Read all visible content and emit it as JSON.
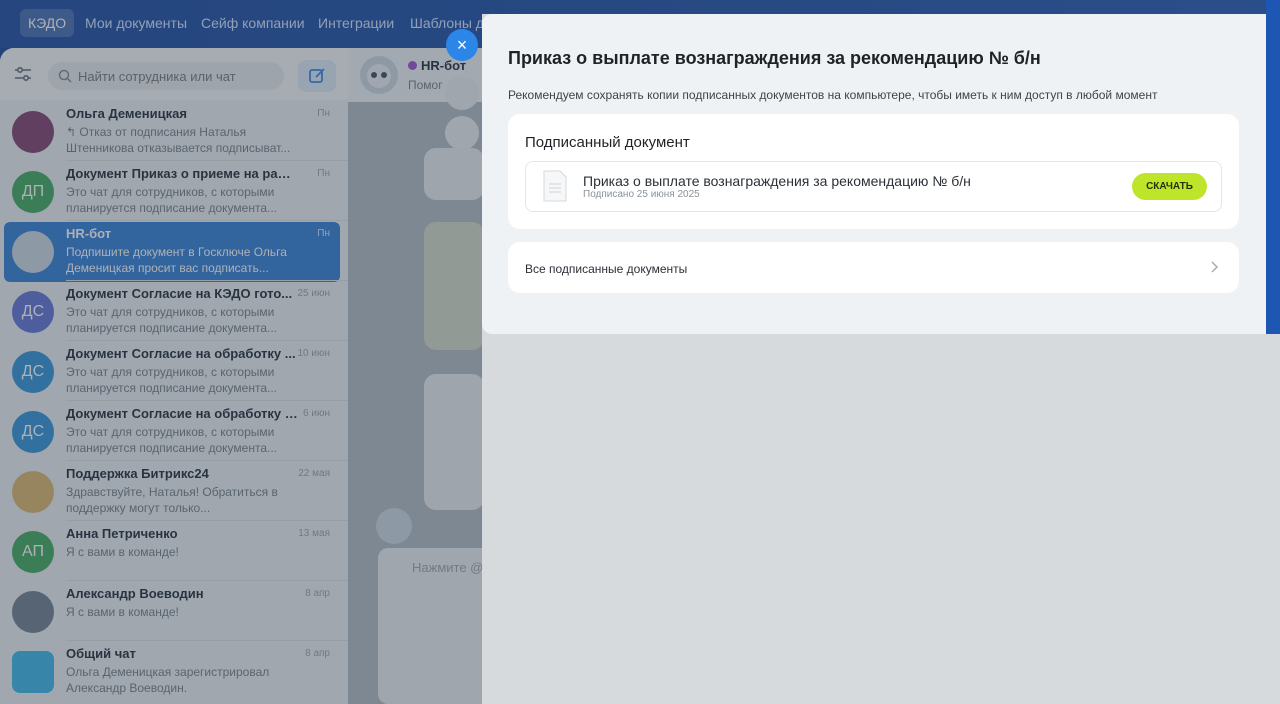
{
  "topnav": {
    "tabs": [
      {
        "label": "КЭДО",
        "active": true
      },
      {
        "label": "Мои документы"
      },
      {
        "label": "Сейф компании"
      },
      {
        "label": "Интеграции"
      },
      {
        "label": "Шаблоны д"
      }
    ]
  },
  "sidebar": {
    "search_placeholder": "Найти сотрудника или чат",
    "chats": [
      {
        "name": "Ольга Деменицкая",
        "date": "Пн",
        "preview": "↰ Отказ от подписания Наталья Штенникова отказывается подписыват...",
        "avatar": "photo"
      },
      {
        "name": "Документ Приказ о приеме на работ...",
        "date": "Пн",
        "preview": "Это чат для сотрудников, с которыми планируется подписание документа...",
        "initials": "ДП",
        "color": "#3aa65a"
      },
      {
        "name": "HR-бот",
        "date": "Пн",
        "preview": "Подпишите документ в Госключе Ольга Деменицкая просит вас подписать...",
        "avatar": "bot",
        "active": true
      },
      {
        "name": "Документ Согласие на КЭДО гото...",
        "date": "25 июн",
        "preview": "Это чат для сотрудников, с которыми планируется подписание документа...",
        "initials": "ДС",
        "color": "#5b6fd6"
      },
      {
        "name": "Документ Согласие на обработку ...",
        "date": "10 июн",
        "preview": "Это чат для сотрудников, с которыми планируется подписание документа...",
        "initials": "ДС",
        "color": "#2a8fd8"
      },
      {
        "name": "Документ Согласие на обработку п...",
        "date": "6 июн",
        "preview": "Это чат для сотрудников, с которыми планируется подписание документа...",
        "initials": "ДС",
        "color": "#2a8fd8"
      },
      {
        "name": "Поддержка Битрикс24",
        "date": "22 мая",
        "preview": "Здравствуйте, Наталья! Обратиться в поддержку могут только...",
        "avatar": "group"
      },
      {
        "name": "Анна Петриченко",
        "date": "13 мая",
        "preview": "Я с вами в команде!",
        "initials": "АП",
        "color": "#3aa65a"
      },
      {
        "name": "Александр Воеводин",
        "date": "8 апр",
        "preview": "Я с вами в команде!",
        "avatar": "photo2"
      },
      {
        "name": "Общий чат",
        "date": "8 апр",
        "preview": "Ольга Деменицкая зарегистрировал Александр Воеводин.",
        "avatar": "chat"
      }
    ]
  },
  "chatarea": {
    "bot_name": "HR-бот",
    "bot_sub": "Помог",
    "input_placeholder": "Нажмите @"
  },
  "panel": {
    "title": "Приказ о выплате вознаграждения за рекомендацию № б/н",
    "subtitle": "Рекомендуем сохранять копии подписанных документов на компьютере, чтобы иметь к ним доступ в любой момент",
    "signed_card_title": "Подписанный документ",
    "doc_name": "Приказ о выплате вознаграждения за рекомендацию № б/н",
    "doc_date": "Подписано 25 июня 2025",
    "download_label": "СКАЧАТЬ",
    "all_docs_label": "Все подписанные документы",
    "close_symbol": "×"
  },
  "colors": {
    "accent": "#2c86e8",
    "download": "#bfe52a",
    "active_chat": "#2b7ad6"
  }
}
